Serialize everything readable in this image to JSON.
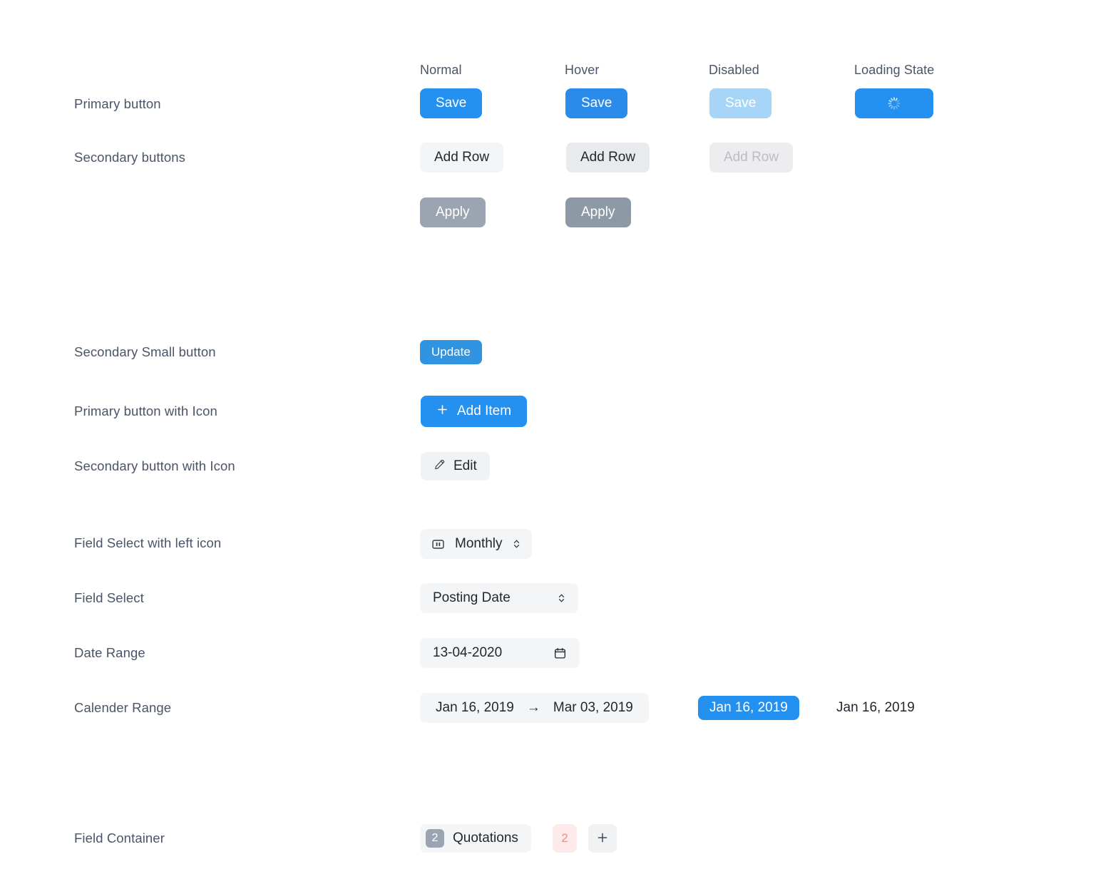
{
  "column_headers": [
    {
      "label": "Normal"
    },
    {
      "label": "Hover"
    },
    {
      "label": "Disabled"
    },
    {
      "label": "Loading State"
    }
  ],
  "rows": {
    "primary_button": {
      "label": "Primary button",
      "normal": "Save",
      "hover": "Save",
      "disabled": "Save",
      "loading_icon": "spinner-icon"
    },
    "secondary_buttons": {
      "label": "Secondary buttons",
      "normal": "Add Row",
      "hover": "Add Row",
      "disabled": "Add Row",
      "apply_normal": "Apply",
      "apply_hover": "Apply"
    },
    "secondary_small_button": {
      "label": "Secondary Small button",
      "value": "Update"
    },
    "primary_button_with_icon": {
      "label": "Primary button with Icon",
      "icon": "plus-icon",
      "value": "Add Item"
    },
    "secondary_button_with_icon": {
      "label": "Secondary button with Icon",
      "icon": "pencil-icon",
      "value": "Edit"
    },
    "field_select_with_left_icon": {
      "label": "Field Select with left icon",
      "left_icon": "columns-icon",
      "value": "Monthly",
      "chevron_icon": "chevron-up-down-icon"
    },
    "field_select": {
      "label": "Field Select",
      "value": "Posting Date",
      "chevron_icon": "chevron-up-down-icon"
    },
    "date_range": {
      "label": "Date Range",
      "value": "13-04-2020",
      "icon": "calendar-icon"
    },
    "calender_range": {
      "label": "Calender Range",
      "from": "Jan 16, 2019",
      "arrow": "→",
      "to": "Mar 03, 2019",
      "selected_date": "Jan 16, 2019",
      "plain_date": "Jan 16, 2019"
    },
    "field_container": {
      "label": "Field Container",
      "count_badge": "2",
      "value": "Quotations",
      "alert_badge": "2",
      "add_icon": "plus-icon"
    }
  },
  "colors": {
    "primary": "#2490ef",
    "primary_hover": "#2b8bea",
    "primary_disabled": "#a6d5f7",
    "secondary_bg": "#f4f5f6",
    "secondary_hover_bg": "#e8eaed",
    "secondary_disabled_text": "#b9bec5",
    "apply_bg": "#9aa5b1",
    "apply_hover_bg": "#8e99a6",
    "label_text": "#4a5568",
    "value_text": "#1f272e",
    "badge_red_bg": "#fdeaea",
    "badge_red_text": "#f08b8b",
    "page_bg": "#ffffff"
  }
}
